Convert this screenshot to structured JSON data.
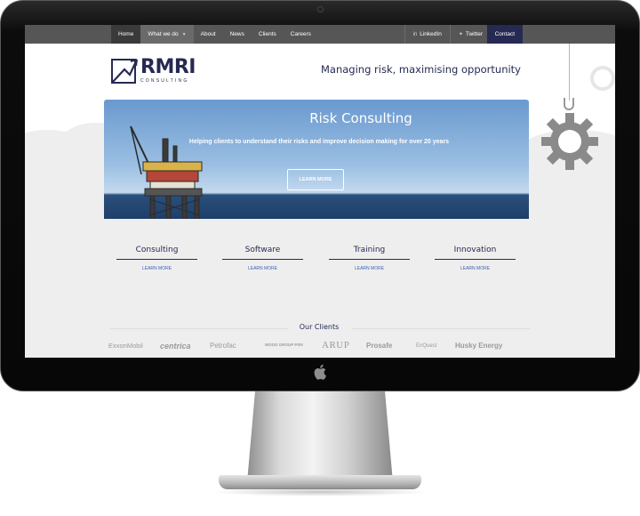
{
  "nav": {
    "items": [
      {
        "label": "Home",
        "active": true
      },
      {
        "label": "What we do",
        "dropdown": true
      },
      {
        "label": "About"
      },
      {
        "label": "News"
      },
      {
        "label": "Clients"
      },
      {
        "label": "Careers"
      }
    ],
    "social": [
      {
        "label": "LinkedIn",
        "icon": "linkedin-icon"
      },
      {
        "label": "Twitter",
        "icon": "twitter-icon"
      }
    ],
    "contact": "Contact"
  },
  "header": {
    "logo_text": "RMRI",
    "logo_subtext": "CONSULTING",
    "tagline": "Managing risk, maximising opportunity"
  },
  "hero": {
    "title": "Risk Consulting",
    "subtitle": "Helping clients to understand their risks and improve decision making for over 20 years",
    "button": "LEARN MORE"
  },
  "services": [
    {
      "title": "Consulting",
      "link": "LEARN MORE"
    },
    {
      "title": "Software",
      "link": "LEARN MORE"
    },
    {
      "title": "Training",
      "link": "LEARN MORE"
    },
    {
      "title": "Innovation",
      "link": "LEARN MORE"
    }
  ],
  "clients": {
    "title": "Our Clients",
    "logos": [
      "ExxonMobil",
      "centrica",
      "Petrofac",
      "WOOD GROUP PSN",
      "ARUP",
      "Prosafe",
      "EnQuest",
      "Husky Energy"
    ]
  },
  "colors": {
    "brand_navy": "#262a52",
    "nav_bg": "#565656",
    "card_bg": "#eeeeee",
    "link_blue": "#3a63b8"
  }
}
